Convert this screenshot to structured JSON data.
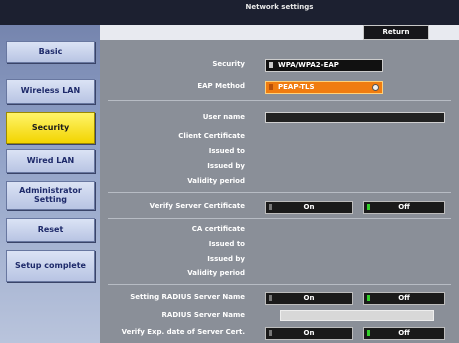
{
  "header": {
    "title": "Network settings",
    "return_label": "Return"
  },
  "sidebar": {
    "items": [
      {
        "label": "Basic"
      },
      {
        "label": "Wireless LAN"
      },
      {
        "label": "Security"
      },
      {
        "label": "Wired LAN"
      },
      {
        "label": "Administrator Setting"
      },
      {
        "label": "Reset"
      },
      {
        "label": "Setup complete"
      }
    ],
    "active_index": 2
  },
  "form": {
    "security_label": "Security",
    "security_value": "WPA/WPA2-EAP",
    "eap_method_label": "EAP Method",
    "eap_method_value": "PEAP-TLS",
    "user_name_label": "User name",
    "client_certificate_label": "Client Certificate",
    "issued_to_label": "Issued to",
    "issued_by_label": "Issued by",
    "validity_period_label": "Validity period",
    "verify_server_cert_label": "Verify Server Certificate",
    "verify_server_cert_on": "On",
    "verify_server_cert_off": "Off",
    "ca_certificate_label": "CA certificate",
    "ca_issued_to_label": "Issued to",
    "ca_issued_by_label": "Issued by",
    "ca_validity_period_label": "Validity period",
    "setting_radius_label": "Setting RADIUS Server Name",
    "setting_radius_on": "On",
    "setting_radius_off": "Off",
    "radius_server_name_label": "RADIUS Server Name",
    "verify_exp_label": "Verify Exp. date of Server Cert.",
    "verify_exp_on": "On",
    "verify_exp_off": "Off"
  },
  "colors": {
    "active_nav": "#f2d400",
    "eap_select": "#f07c10",
    "selected_indicator": "#33d02a"
  }
}
